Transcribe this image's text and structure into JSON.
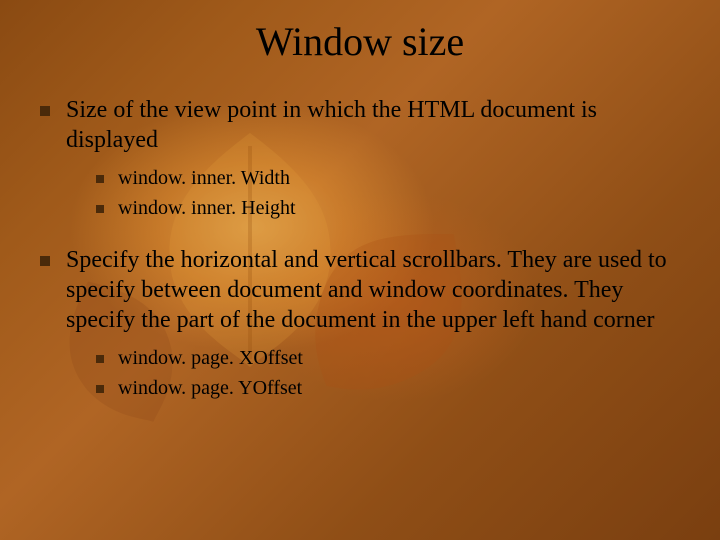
{
  "title": "Window size",
  "bullets": [
    {
      "text": "Size of the view point in which the HTML document is displayed",
      "sub": [
        "window. inner. Width",
        "window. inner. Height"
      ]
    },
    {
      "text": "Specify the horizontal and vertical scrollbars. They are used to specify between document and window coordinates. They specify the part of the document in the upper left hand corner",
      "sub": [
        "window. page. XOffset",
        "window. page. YOffset"
      ]
    }
  ]
}
